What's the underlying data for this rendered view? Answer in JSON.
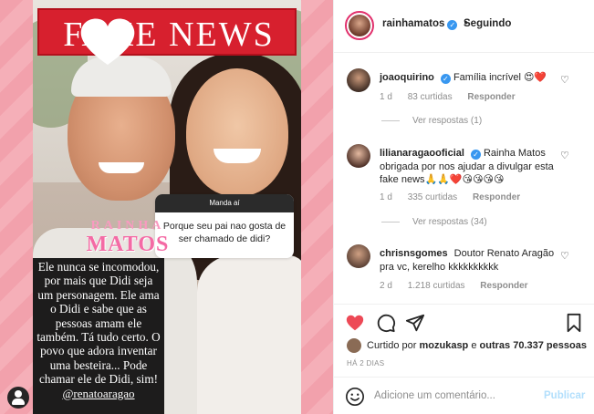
{
  "post": {
    "banner_text": "FAKE NEWS",
    "question": {
      "header": "Manda aí",
      "text": "Porque seu pai nao gosta de ser chamado de didi?"
    },
    "brand_line1": "RAINHA",
    "brand_line2": "MATOS",
    "answer": "Ele nunca se incomodou, por mais que Didi seja um personagem. Ele ama o Didi e sabe que as pessoas amam ele também. Tá tudo certo. O povo que adora inventar uma besteira... Pode chamar ele de Didi, sim!",
    "answer_handle": "@renatoaragao"
  },
  "header": {
    "username": "rainhamatos",
    "verified_mark": "✓",
    "separator": "•",
    "follow_status": "Seguindo"
  },
  "comments": [
    {
      "username": "joaoquirino",
      "verified": true,
      "text": "Família incrível 😍❤️",
      "time": "1 d",
      "likes": "83 curtidas",
      "reply_label": "Responder",
      "view_replies": "Ver respostas (1)"
    },
    {
      "username": "lilianaragaooficial",
      "verified": true,
      "text": "Rainha Matos obrigada por nos ajudar a divulgar esta fake news🙏🙏❤️😘😘😘😘",
      "time": "1 d",
      "likes": "335 curtidas",
      "reply_label": "Responder",
      "view_replies": "Ver respostas (34)"
    },
    {
      "username": "chrisnsgomes",
      "verified": false,
      "text": "Doutor Renato Aragão pra vc, kerelho kkkkkkkkkk",
      "time": "2 d",
      "likes": "1.218 curtidas",
      "reply_label": "Responder"
    }
  ],
  "likes_summary": {
    "prefix": "Curtido por",
    "user": "mozukasp",
    "middle": "e",
    "others": "outras 70.337 pessoas"
  },
  "post_date": "HÁ 2 DIAS",
  "add_comment": {
    "placeholder": "Adicione um comentário...",
    "publish_label": "Publicar"
  },
  "colors": {
    "like_red": "#ed4956",
    "verified_blue": "#3897f0",
    "publish_disabled": "#b2dffc",
    "banner_red": "#d7202e"
  }
}
